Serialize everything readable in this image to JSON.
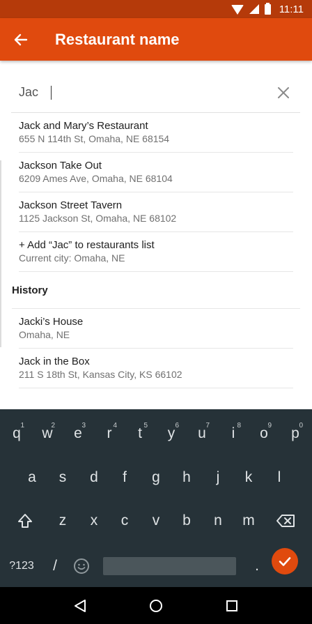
{
  "status_bar": {
    "time": "11:11"
  },
  "app_bar": {
    "title": "Restaurant name",
    "accent_color": "#e04a0e"
  },
  "search": {
    "value": "Jac"
  },
  "results": [
    {
      "name": "Jack and Mary’s Restaurant",
      "address": "655 N 114th St, Omaha, NE 68154"
    },
    {
      "name": "Jackson Take Out",
      "address": "6209 Ames Ave, Omaha, NE 68104"
    },
    {
      "name": "Jackson Street Tavern",
      "address": "1125 Jackson St, Omaha, NE 68102"
    },
    {
      "name": "+ Add “Jac” to restaurants list",
      "address": "Current city: Omaha, NE"
    }
  ],
  "history": {
    "header": "History",
    "items": [
      {
        "name": "Jacki’s House",
        "address": "Omaha, NE"
      },
      {
        "name": "Jack in the Box",
        "address": "211 S 18th St, Kansas City, KS 66102"
      }
    ]
  },
  "keyboard": {
    "row1": [
      "q",
      "w",
      "e",
      "r",
      "t",
      "y",
      "u",
      "i",
      "o",
      "p"
    ],
    "row1_hints": [
      "1",
      "2",
      "3",
      "4",
      "5",
      "6",
      "7",
      "8",
      "9",
      "0"
    ],
    "row2": [
      "a",
      "s",
      "d",
      "f",
      "g",
      "h",
      "j",
      "k",
      "l"
    ],
    "row3": [
      "z",
      "x",
      "c",
      "v",
      "b",
      "n",
      "m"
    ],
    "symbols_label": "?123",
    "slash": "/",
    "period": "."
  }
}
